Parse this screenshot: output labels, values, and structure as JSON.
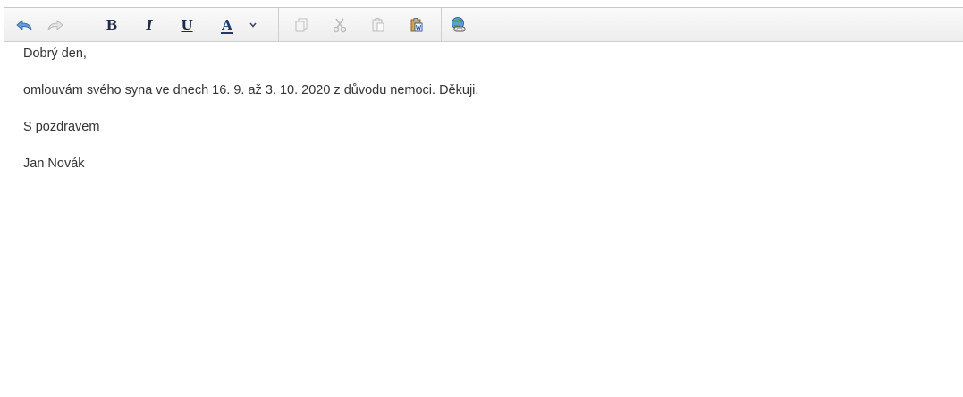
{
  "toolbar": {
    "buttons": [
      {
        "name": "undo-icon",
        "enabled": true
      },
      {
        "name": "redo-icon",
        "enabled": false
      },
      {
        "name": "bold-button",
        "label": "B"
      },
      {
        "name": "italic-button",
        "label": "I"
      },
      {
        "name": "underline-button",
        "label": "U"
      },
      {
        "name": "font-color-button",
        "label": "A"
      },
      {
        "name": "font-color-dropdown",
        "icon": "chevron-down-icon"
      },
      {
        "name": "copy-icon",
        "enabled": false
      },
      {
        "name": "cut-icon",
        "enabled": false
      },
      {
        "name": "paste-icon",
        "enabled": false
      },
      {
        "name": "paste-from-word-icon",
        "enabled": true
      },
      {
        "name": "insert-link-icon",
        "enabled": true
      }
    ],
    "bold_label": "B",
    "italic_label": "I",
    "underline_label": "U",
    "font_color_label": "A"
  },
  "content": {
    "lines": [
      "Dobrý den,",
      "omlouvám svého syna ve dnech 16. 9. až 3. 10. 2020 z důvodu nemoci. Děkuji.",
      "S pozdravem",
      "Jan Novák"
    ]
  },
  "colors": {
    "toolbar_bg": "#f0f0f0",
    "icon_active": "#3a6fb0",
    "icon_disabled": "#b9b9b9",
    "text": "#333333",
    "format_text": "#1e2a44"
  }
}
